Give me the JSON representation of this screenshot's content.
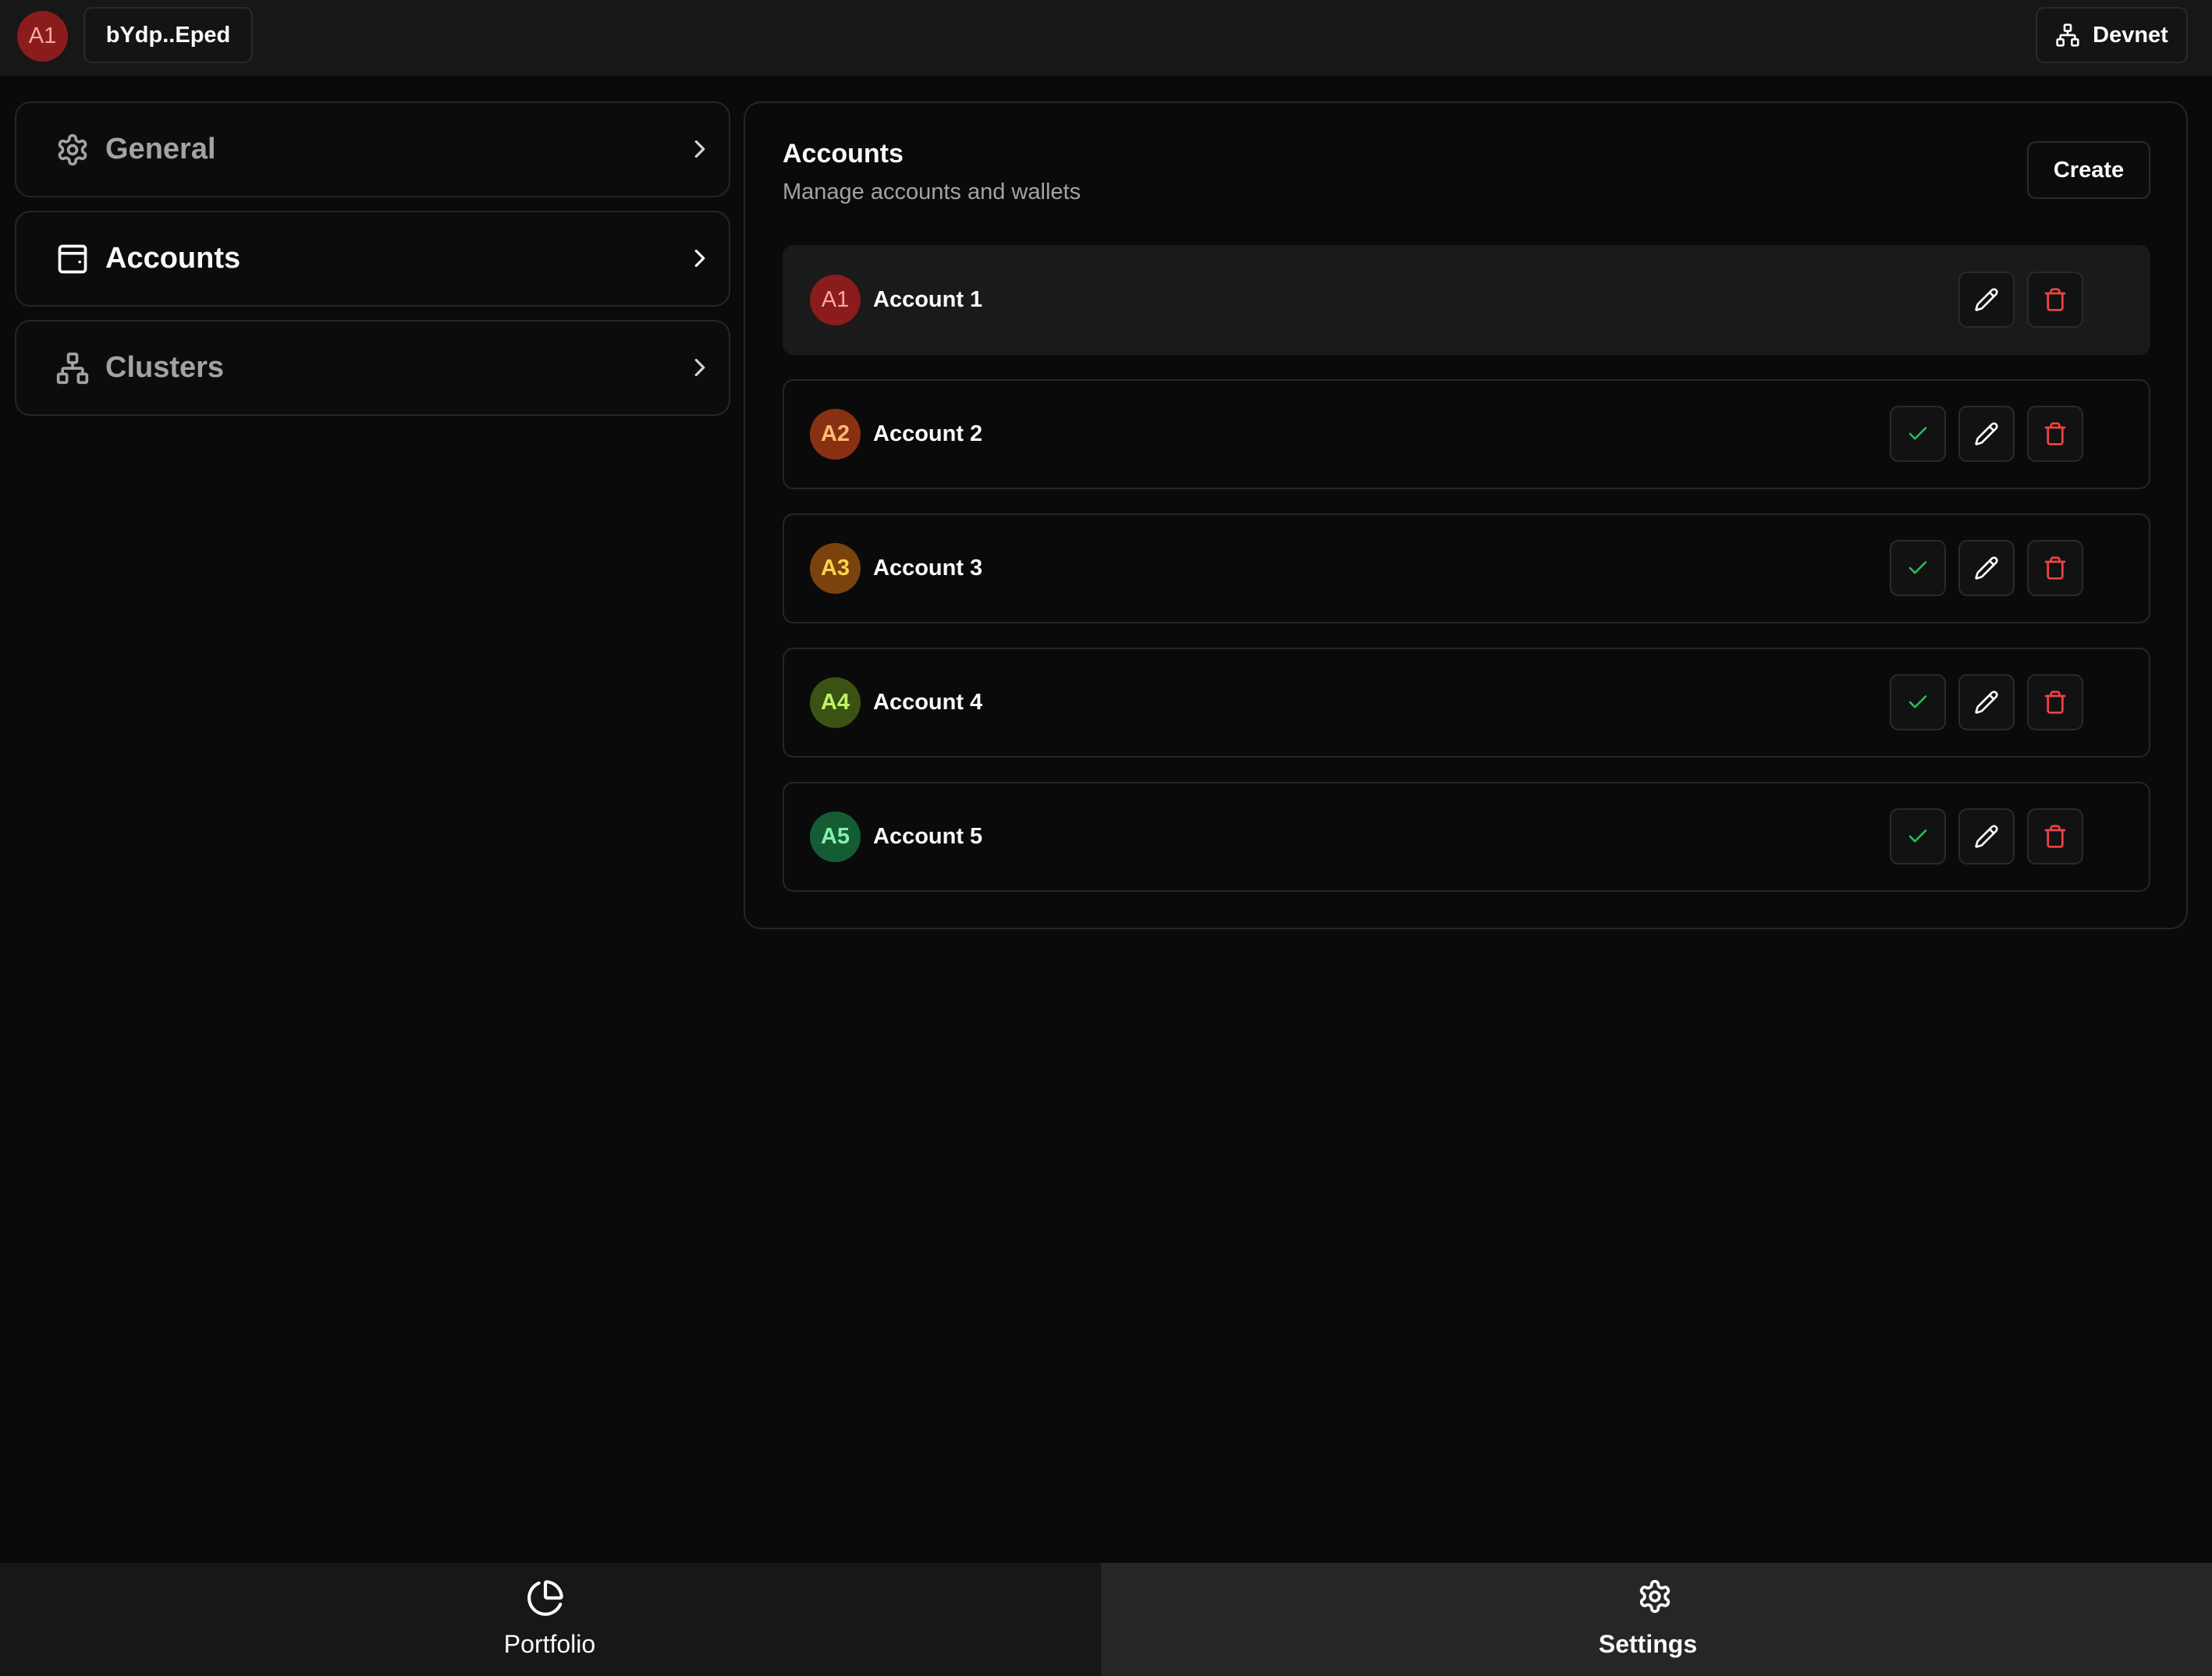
{
  "header": {
    "current_account_initials": "A1",
    "current_account_color": "#8b1c1c",
    "wallet_address": "bYdp..Eped",
    "cluster_label": "Devnet"
  },
  "sidebar": {
    "items": [
      {
        "label": "General",
        "icon": "gear-icon",
        "active": false
      },
      {
        "label": "Accounts",
        "icon": "wallet-icon",
        "active": true
      },
      {
        "label": "Clusters",
        "icon": "network-icon",
        "active": false
      }
    ]
  },
  "main": {
    "title": "Accounts",
    "subtitle": "Manage accounts and wallets",
    "create_label": "Create",
    "accounts": [
      {
        "initials": "A1",
        "name": "Account 1",
        "bg": "#8b1c1c",
        "fg": "#fca5a5",
        "current": true
      },
      {
        "initials": "A2",
        "name": "Account 2",
        "bg": "#8a3012",
        "fg": "#fdba74",
        "current": false
      },
      {
        "initials": "A3",
        "name": "Account 3",
        "bg": "#7a420c",
        "fg": "#fcd34d",
        "current": false
      },
      {
        "initials": "A4",
        "name": "Account 4",
        "bg": "#3b5312",
        "fg": "#bef264",
        "current": false
      },
      {
        "initials": "A5",
        "name": "Account 5",
        "bg": "#145c34",
        "fg": "#86efac",
        "current": false
      }
    ]
  },
  "bottom_nav": {
    "tabs": [
      {
        "label": "Portfolio",
        "icon": "pie-chart-icon",
        "active": false
      },
      {
        "label": "Settings",
        "icon": "gear-icon",
        "active": true
      }
    ]
  },
  "colors": {
    "check": "#22c55e",
    "delete": "#ef4444",
    "edit": "#fafafa"
  }
}
